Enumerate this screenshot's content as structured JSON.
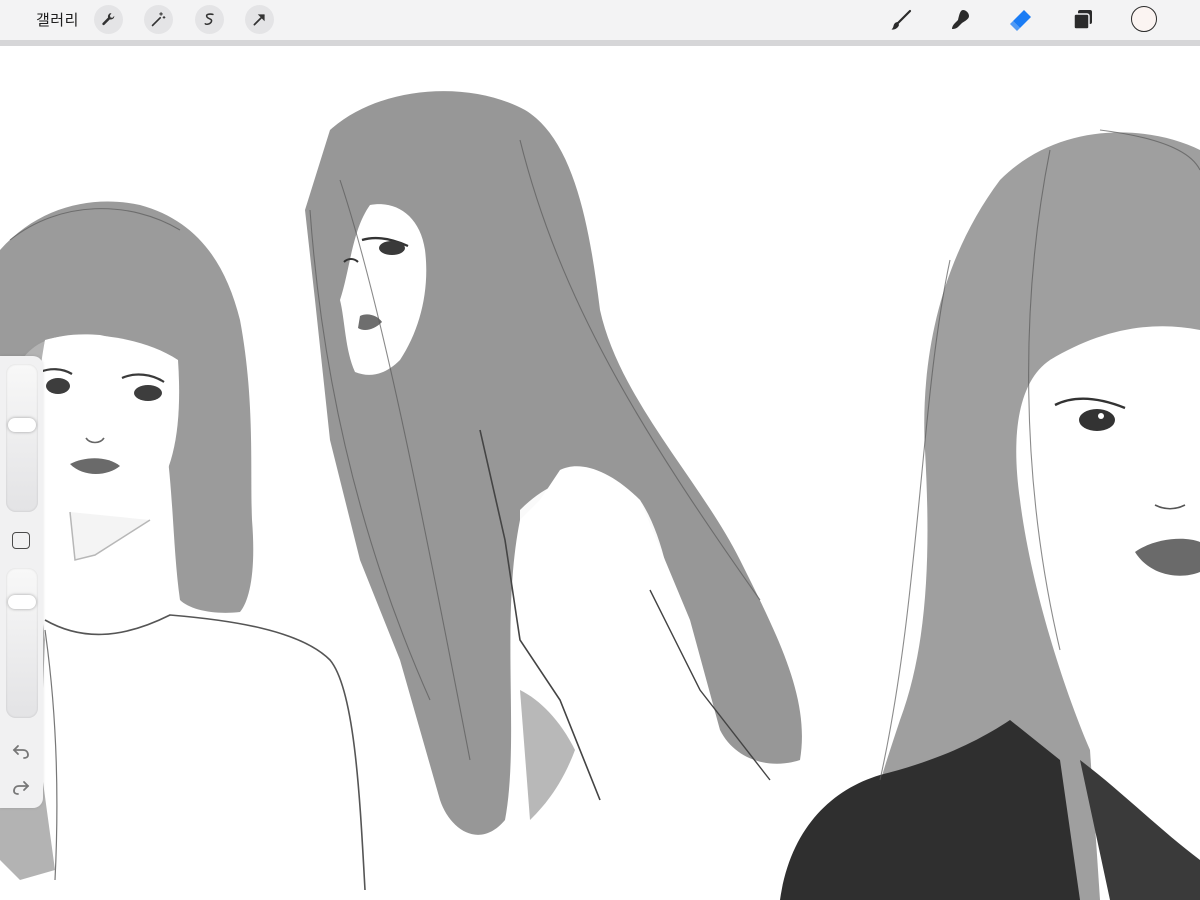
{
  "app": {
    "gallery_label": "갤러리"
  },
  "toolbar": {
    "left_tools": [
      "wrench-icon",
      "magic-wand-icon",
      "selection-icon",
      "transform-arrow-icon"
    ],
    "right_tools": [
      "brush-icon",
      "smudge-icon",
      "eraser-icon",
      "layers-icon"
    ],
    "active_tool": "eraser",
    "active_color": "#fbf4f2",
    "accent_color": "#1a7cf5"
  },
  "sidebar": {
    "brush_size_level": 0.6,
    "opacity_level": 0.2,
    "modify_icon": "square-icon",
    "undo_icon": "undo-icon",
    "redo_icon": "redo-icon"
  }
}
